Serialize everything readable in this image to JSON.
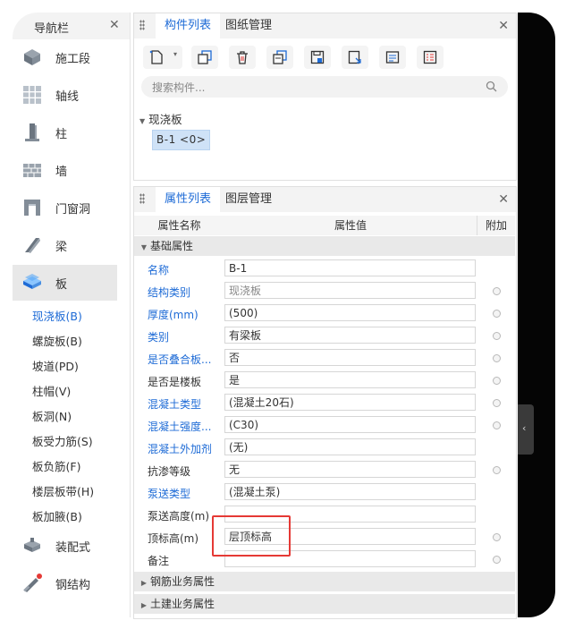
{
  "nav": {
    "title": "导航栏",
    "items": [
      {
        "label": "施工段",
        "icon": "construction-section-icon"
      },
      {
        "label": "轴线",
        "icon": "grid-axis-icon"
      },
      {
        "label": "柱",
        "icon": "column-icon"
      },
      {
        "label": "墙",
        "icon": "wall-icon"
      },
      {
        "label": "门窗洞",
        "icon": "door-window-icon"
      },
      {
        "label": "梁",
        "icon": "beam-icon"
      },
      {
        "label": "板",
        "icon": "slab-icon"
      }
    ],
    "sub_items": [
      "现浇板(B)",
      "螺旋板(B)",
      "坡道(PD)",
      "柱帽(V)",
      "板洞(N)",
      "板受力筋(S)",
      "板负筋(F)",
      "楼层板带(H)",
      "板加腋(B)"
    ],
    "bottom_items": [
      {
        "label": "装配式",
        "icon": "prefab-icon"
      },
      {
        "label": "钢结构",
        "icon": "steel-structure-icon"
      }
    ]
  },
  "components": {
    "tabs": [
      "构件列表",
      "图纸管理"
    ],
    "search_placeholder": "搜索构件...",
    "tree_root": "现浇板",
    "tree_item": "B-1 <0>"
  },
  "properties": {
    "tabs": [
      "属性列表",
      "图层管理"
    ],
    "columns": [
      "属性名称",
      "属性值",
      "附加"
    ],
    "group_basic": "基础属性",
    "rows": [
      {
        "name": "名称",
        "value": "B-1"
      },
      {
        "name": "结构类别",
        "value": "现浇板"
      },
      {
        "name": "厚度(mm)",
        "value": "(500)"
      },
      {
        "name": "类别",
        "value": "有梁板"
      },
      {
        "name": "是否叠合板...",
        "value": "否"
      },
      {
        "name": "是否是楼板",
        "value": "是"
      },
      {
        "name": "混凝土类型",
        "value": "(混凝土20石)"
      },
      {
        "name": "混凝土强度...",
        "value": "(C30)"
      },
      {
        "name": "混凝土外加剂",
        "value": "(无)"
      },
      {
        "name": "抗渗等级",
        "value": "无"
      },
      {
        "name": "泵送类型",
        "value": "(混凝土泵)"
      },
      {
        "name": "泵送高度(m)",
        "value": ""
      },
      {
        "name": "顶标高(m)",
        "value": "层顶标高"
      },
      {
        "name": "备注",
        "value": ""
      }
    ],
    "group_rebar": "钢筋业务属性",
    "group_civil": "土建业务属性"
  },
  "colors": {
    "accent": "#1e6bd6",
    "highlight": "#e53935",
    "selected_chip": "#cfe2f7"
  }
}
